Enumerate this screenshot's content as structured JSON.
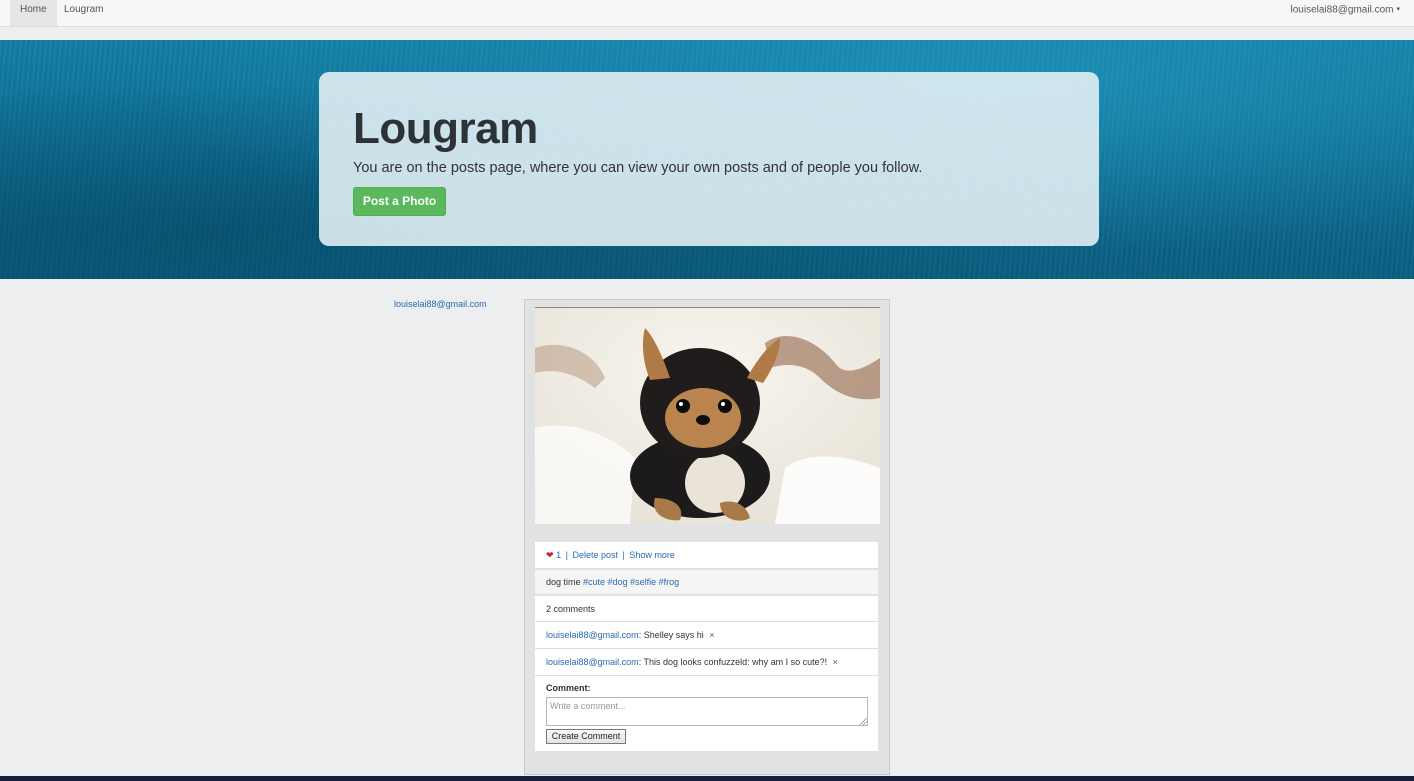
{
  "nav": {
    "home": "Home",
    "brand": "Lougram",
    "user": "louiselai88@gmail.com",
    "caret": "▾"
  },
  "hero": {
    "title": "Lougram",
    "lead": "You are on the posts page, where you can view your own posts and of people you follow.",
    "post_button": "Post a Photo"
  },
  "sidebar": {
    "user": "louiselai88@gmail.com"
  },
  "post": {
    "image_alt": "puppy-photo",
    "likes_icon": "❤",
    "likes": "1",
    "separator": "|",
    "delete": "Delete post",
    "show_more": "Show more",
    "caption_text": "dog time",
    "tags": [
      "#cute",
      "#dog",
      "#selfie",
      "#frog"
    ],
    "comment_count": "2 comments",
    "comments": [
      {
        "author": "louiselai88@gmail.com",
        "text": ": Shelley says hi",
        "remove": "×"
      },
      {
        "author": "louiselai88@gmail.com",
        "text": ": This dog looks confuzzeld: why am I so cute?!",
        "remove": "×"
      }
    ],
    "form": {
      "label": "Comment:",
      "placeholder": "Write a comment...",
      "submit": "Create Comment"
    }
  },
  "colors": {
    "accent_green": "#5cb85c",
    "link": "#2a6ab0",
    "heart": "#cc2222"
  }
}
